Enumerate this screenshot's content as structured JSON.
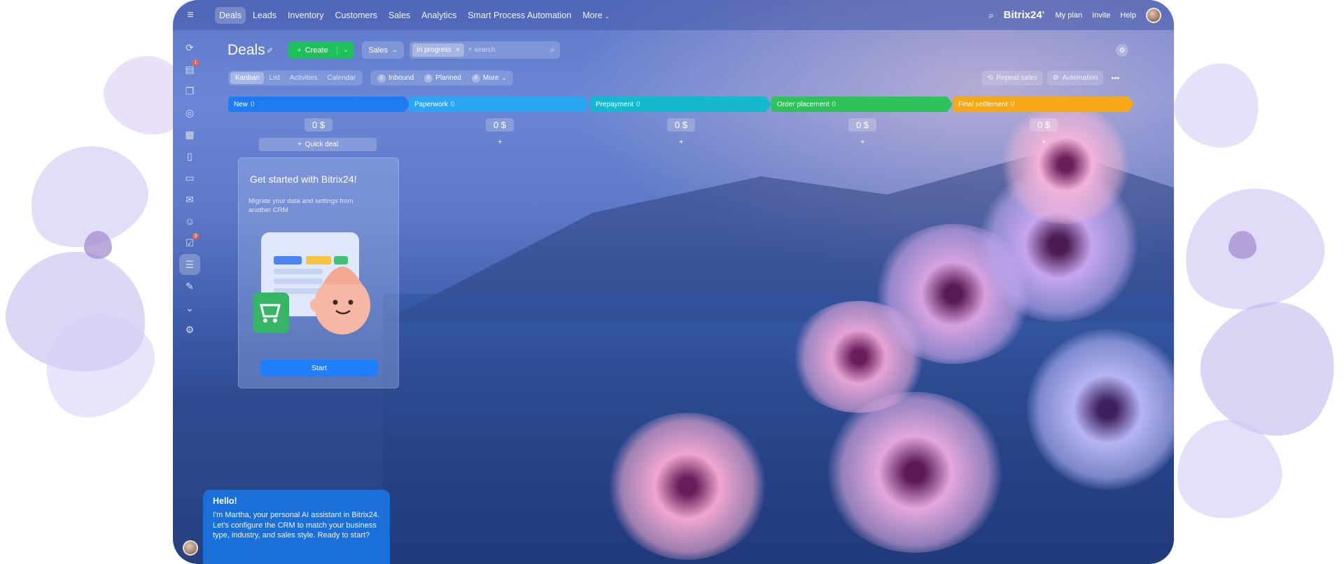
{
  "topbar": {
    "nav": [
      "Deals",
      "Leads",
      "Inventory",
      "Customers",
      "Sales",
      "Analytics",
      "Smart Process Automation",
      "More"
    ],
    "brand": "Bitrix24",
    "links": [
      "My plan",
      "Invite",
      "Help"
    ]
  },
  "sidebar": {
    "badges": {
      "tasks": "1",
      "todo": "3"
    }
  },
  "header": {
    "title": "Deals",
    "create_label": "Create",
    "pipeline": "Sales",
    "filter_chip": "In progress",
    "search_placeholder": "+ search"
  },
  "toolbar": {
    "views": [
      "Kanban",
      "List",
      "Activities",
      "Calendar"
    ],
    "counters": [
      {
        "n": "0",
        "label": "Inbound"
      },
      {
        "n": "0",
        "label": "Planned"
      },
      {
        "n": "0",
        "label": "More"
      }
    ],
    "repeat_sales": "Repeat sales",
    "automation": "Automation"
  },
  "stages": [
    {
      "name": "New",
      "count": "0",
      "sum": "0 $",
      "color": "#1f7cf0"
    },
    {
      "name": "Paperwork",
      "count": "0",
      "sum": "0 $",
      "color": "#2ba6f5"
    },
    {
      "name": "Prepayment",
      "count": "0",
      "sum": "0 $",
      "color": "#14b9cf"
    },
    {
      "name": "Order placement",
      "count": "0",
      "sum": "0 $",
      "color": "#2fc15a"
    },
    {
      "name": "Final settlement",
      "count": "0",
      "sum": "0 $",
      "color": "#f7a816"
    }
  ],
  "quick_deal": "Quick deal",
  "onboarding": {
    "title": "Get started with Bitrix24!",
    "text": "Migrate your data and settings from another CRM",
    "button": "Start"
  },
  "assistant": {
    "greeting": "Hello!",
    "message": "I'm Martha, your personal AI assistant in Bitrix24. Let's configure the CRM to match your business type, industry, and sales style. Ready to start?"
  }
}
